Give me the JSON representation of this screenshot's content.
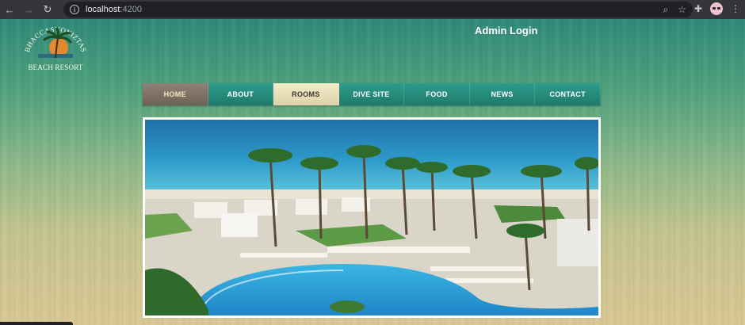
{
  "browser": {
    "url_host": "localhost",
    "url_port": ":4200",
    "icons": [
      "back-arrow-icon",
      "forward-arrow-icon",
      "reload-icon",
      "info-icon",
      "zoom-icon",
      "star-icon",
      "extensions-icon",
      "profile-avatar-icon",
      "menu-icon"
    ]
  },
  "site": {
    "logo": {
      "arc_text": "BHACCASYONIZTAS",
      "subtitle": "BEACH RESORT"
    },
    "admin_login": "Admin Login",
    "nav": [
      {
        "label": "HOME"
      },
      {
        "label": "ABOUT"
      },
      {
        "label": "ROOMS"
      },
      {
        "label": "DIVE SITE"
      },
      {
        "label": "FOOD"
      },
      {
        "label": "NEWS"
      },
      {
        "label": "CONTACT"
      }
    ]
  },
  "colors": {
    "nav_teal": "#1e7a6c",
    "nav_home": "#6e6157",
    "nav_rooms": "#dcd2a8",
    "page_top": "#2f8a7a",
    "page_bottom": "#dac894"
  }
}
